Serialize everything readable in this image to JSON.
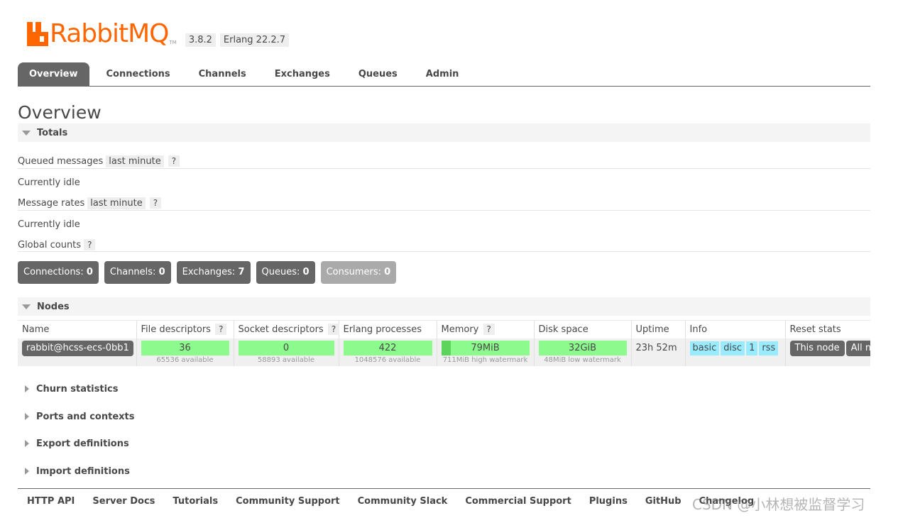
{
  "header": {
    "logo_text": "RabbitMQ",
    "logo_tm": "TM",
    "version": "3.8.2",
    "erlang": "Erlang 22.2.7"
  },
  "tabs": [
    {
      "label": "Overview",
      "active": true
    },
    {
      "label": "Connections"
    },
    {
      "label": "Channels"
    },
    {
      "label": "Exchanges"
    },
    {
      "label": "Queues"
    },
    {
      "label": "Admin"
    }
  ],
  "page_title": "Overview",
  "totals": {
    "title": "Totals",
    "queued_label": "Queued messages",
    "queued_range": "last minute",
    "help": "?",
    "queued_status": "Currently idle",
    "rates_label": "Message rates",
    "rates_range": "last minute",
    "rates_status": "Currently idle",
    "global_label": "Global counts",
    "counts": [
      {
        "label": "Connections:",
        "value": "0"
      },
      {
        "label": "Channels:",
        "value": "0"
      },
      {
        "label": "Exchanges:",
        "value": "7"
      },
      {
        "label": "Queues:",
        "value": "0"
      },
      {
        "label": "Consumers:",
        "value": "0"
      }
    ]
  },
  "nodes": {
    "title": "Nodes",
    "columns": [
      "Name",
      "File descriptors",
      "Socket descriptors",
      "Erlang processes",
      "Memory",
      "Disk space",
      "Uptime",
      "Info",
      "Reset stats"
    ],
    "row": {
      "name": "rabbit@hcss-ecs-0bb1",
      "fd": "36",
      "fd_sub": "65536 available",
      "sd": "0",
      "sd_sub": "58893 available",
      "ep": "422",
      "ep_sub": "1048576 available",
      "mem": "79MiB",
      "mem_sub": "711MiB high watermark",
      "mem_fraction": 0.11,
      "disk": "32GiB",
      "disk_sub": "48MiB low watermark",
      "uptime": "23h 52m",
      "info": [
        "basic",
        "disc",
        "1",
        "rss"
      ],
      "reset": [
        "This node",
        "All nodes"
      ]
    }
  },
  "sections": [
    "Churn statistics",
    "Ports and contexts",
    "Export definitions",
    "Import definitions"
  ],
  "footer": [
    "HTTP API",
    "Server Docs",
    "Tutorials",
    "Community Support",
    "Community Slack",
    "Commercial Support",
    "Plugins",
    "GitHub",
    "Changelog"
  ],
  "watermark": "CSDN @小林想被监督学习",
  "colors": {
    "brand": "#ff6600",
    "tab_active": "#666666",
    "bar_green": "#8dfa8d",
    "info_blue": "#99ebff"
  }
}
